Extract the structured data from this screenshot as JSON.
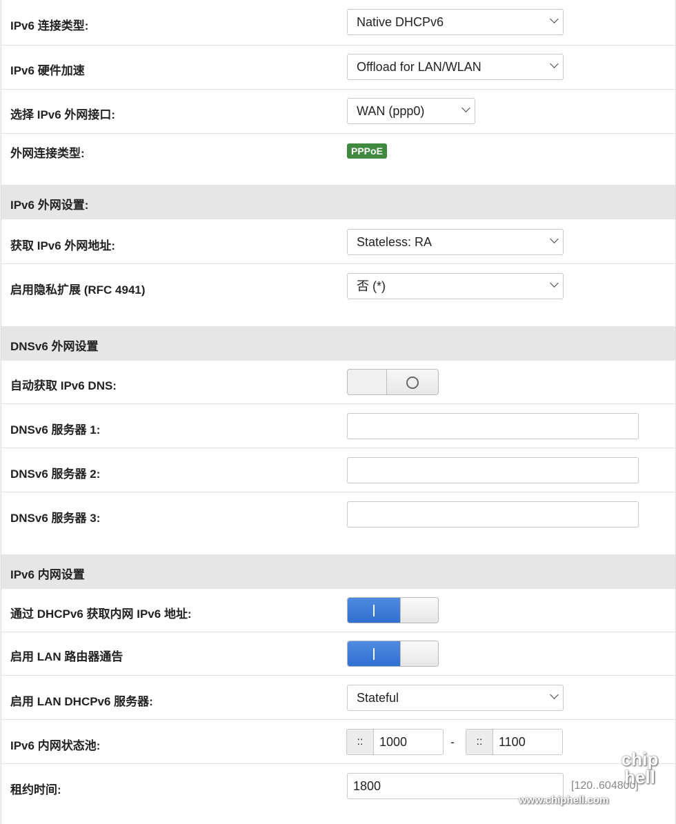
{
  "rows": {
    "conn_type": {
      "label": "IPv6 连接类型:",
      "value": "Native DHCPv6"
    },
    "hw_accel": {
      "label": "IPv6 硬件加速",
      "value": "Offload for LAN/WLAN"
    },
    "wan_iface": {
      "label": "选择 IPv6 外网接口:",
      "value": "WAN (ppp0)"
    },
    "wan_type": {
      "label": "外网连接类型:",
      "badge": "PPPoE",
      "badge_color": "#3f8a3f"
    }
  },
  "section_wan": {
    "title": "IPv6 外网设置:"
  },
  "wan": {
    "get_addr": {
      "label": "获取 IPv6 外网地址:",
      "value": "Stateless: RA"
    },
    "privacy": {
      "label": "启用隐私扩展 (RFC 4941)",
      "value": "否 (*)"
    }
  },
  "section_dns": {
    "title": "DNSv6 外网设置"
  },
  "dns": {
    "auto": {
      "label": "自动获取 IPv6 DNS:",
      "state": "off"
    },
    "server1": {
      "label": "DNSv6 服务器 1:",
      "value": ""
    },
    "server2": {
      "label": "DNSv6 服务器 2:",
      "value": ""
    },
    "server3": {
      "label": "DNSv6 服务器 3:",
      "value": ""
    }
  },
  "section_lan": {
    "title": "IPv6 内网设置"
  },
  "lan": {
    "dhcp_addr": {
      "label": "通过 DHCPv6 获取内网 IPv6 地址:",
      "state": "on"
    },
    "router_adv": {
      "label": "启用 LAN 路由器通告",
      "state": "on"
    },
    "dhcp_server": {
      "label": "启用 LAN DHCPv6 服务器:",
      "value": "Stateful"
    },
    "pool": {
      "label": "IPv6 内网状态池:",
      "prefix": "::",
      "start": "1000",
      "separator": "-",
      "end": "1100"
    },
    "lease": {
      "label": "租约时间:",
      "value": "1800",
      "hint": "[120..604800]"
    }
  },
  "accent_color": "#2f6fd0",
  "watermark": {
    "site": "www.chiphell.com",
    "logo": "chip hell"
  }
}
